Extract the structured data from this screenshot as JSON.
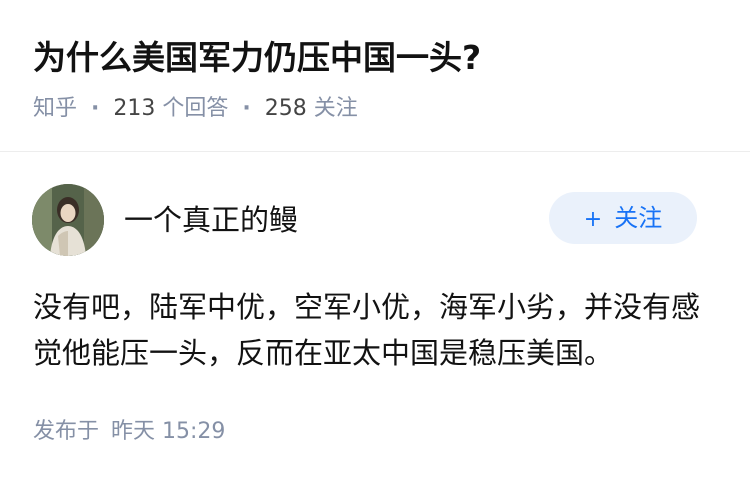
{
  "question": {
    "title": "为什么美国军力仍压中国一头?",
    "source": "知乎",
    "answer_count": "213",
    "answer_label": "个回答",
    "follow_count": "258",
    "follow_label": "关注"
  },
  "author": {
    "name": "一个真正的鳗",
    "follow_plus": "+",
    "follow_label": "关注"
  },
  "answer": {
    "content": "没有吧，陆军中优，空军小优，海军小劣，并没有感觉他能压一头，反而在亚太中国是稳压美国。"
  },
  "publish": {
    "label": "发布于",
    "time": "昨天 15:29"
  },
  "colors": {
    "meta_gray": "#8590a6",
    "accent_blue": "#1772f6",
    "follow_bg": "#eaf1fb"
  },
  "icons": {
    "avatar": "user-avatar"
  }
}
